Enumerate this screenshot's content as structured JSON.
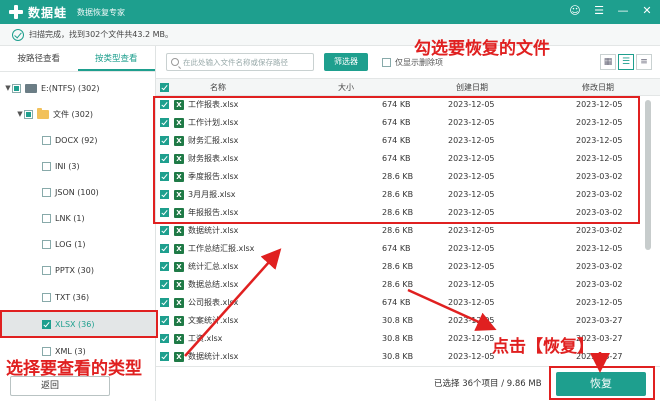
{
  "title_bar": {
    "app_name": "数据蛙",
    "subtitle": "数据恢复专家",
    "controls": [
      "☺",
      "☰",
      "—",
      "✕"
    ]
  },
  "status": {
    "text": "扫描完成，找到302个文件共43.2 MB。"
  },
  "sidebar": {
    "tabs": [
      "按路径查看",
      "按类型查看"
    ],
    "active_tab": 1,
    "drive": "E:(NTFS) (302)",
    "folder": "文件 (302)",
    "types": [
      "DOCX (92)",
      "INI (3)",
      "JSON (100)",
      "LNK (1)",
      "LOG (1)",
      "PPTX (30)",
      "TXT (36)",
      "XLSX (36)",
      "XML (3)"
    ],
    "selected_type": "XLSX (36)",
    "back_label": "返回"
  },
  "toolbar": {
    "search_placeholder": "在此处输入文件名称或保存路径",
    "filter_label": "筛选器",
    "only_deleted_label": "仅显示删除项"
  },
  "table": {
    "columns": {
      "name": "名称",
      "size": "大小",
      "created": "创建日期",
      "modified": "修改日期"
    },
    "rows": [
      {
        "name": "工作报表.xlsx",
        "size": "674 KB",
        "created": "2023-12-05",
        "modified": "2023-12-05"
      },
      {
        "name": "工作计划.xlsx",
        "size": "674 KB",
        "created": "2023-12-05",
        "modified": "2023-12-05"
      },
      {
        "name": "财务汇报.xlsx",
        "size": "674 KB",
        "created": "2023-12-05",
        "modified": "2023-12-05"
      },
      {
        "name": "财务报表.xlsx",
        "size": "674 KB",
        "created": "2023-12-05",
        "modified": "2023-12-05"
      },
      {
        "name": "季度报告.xlsx",
        "size": "28.6 KB",
        "created": "2023-12-05",
        "modified": "2023-03-02"
      },
      {
        "name": "3月月报.xlsx",
        "size": "28.6 KB",
        "created": "2023-12-05",
        "modified": "2023-03-02"
      },
      {
        "name": "年报报告.xlsx",
        "size": "28.6 KB",
        "created": "2023-12-05",
        "modified": "2023-03-02"
      },
      {
        "name": "数据统计.xlsx",
        "size": "28.6 KB",
        "created": "2023-12-05",
        "modified": "2023-03-02"
      },
      {
        "name": "工作总结汇报.xlsx",
        "size": "674 KB",
        "created": "2023-12-05",
        "modified": "2023-12-05"
      },
      {
        "name": "统计汇总.xlsx",
        "size": "28.6 KB",
        "created": "2023-12-05",
        "modified": "2023-03-02"
      },
      {
        "name": "数据总结.xlsx",
        "size": "28.6 KB",
        "created": "2023-12-05",
        "modified": "2023-03-02"
      },
      {
        "name": "公司报表.xlsx",
        "size": "674 KB",
        "created": "2023-12-05",
        "modified": "2023-12-05"
      },
      {
        "name": "文案统计.xlsx",
        "size": "30.8 KB",
        "created": "2023-12-05",
        "modified": "2023-03-27"
      },
      {
        "name": "工资.xlsx",
        "size": "30.8 KB",
        "created": "2023-12-05",
        "modified": "2023-03-27"
      },
      {
        "name": "数据统计.xlsx",
        "size": "30.8 KB",
        "created": "2023-12-05",
        "modified": "2023-03-27"
      }
    ]
  },
  "bottom": {
    "selection_info": "已选择 36个项目 / 9.86 MB",
    "recover_label": "恢复"
  },
  "annotations": {
    "select_files": "勾选要恢复的文件",
    "select_type": "选择要查看的类型",
    "click_recover": "点击【恢复】"
  },
  "colors": {
    "accent": "#1e9f8e",
    "annotation": "#e02020"
  }
}
